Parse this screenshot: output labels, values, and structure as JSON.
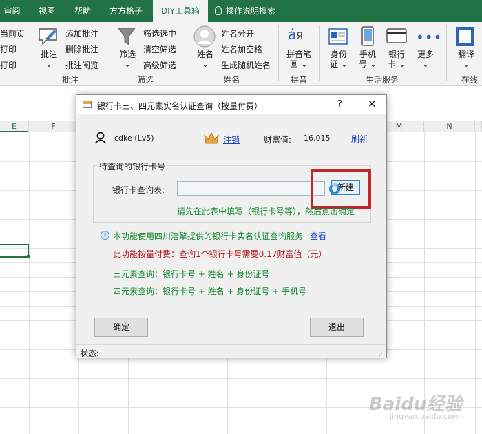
{
  "ribbon_tabs": [
    "审阅",
    "视图",
    "帮助",
    "方方格子",
    "DIY工具箱",
    "操作说明搜索"
  ],
  "ribbon": {
    "left_partial": [
      "当前页",
      "打印",
      "打印"
    ],
    "comment_group": {
      "big": "批注",
      "items": [
        "添加批注",
        "删除批注",
        "批注阅览"
      ],
      "label": "批注"
    },
    "filter_group": {
      "big": "筛选",
      "items": [
        "筛选选中",
        "清空筛选",
        "高级筛选"
      ],
      "label": "筛选"
    },
    "name_group": {
      "big": "姓名",
      "items": [
        "姓名分开",
        "姓名加空格",
        "生成随机姓名"
      ],
      "label": "姓名"
    },
    "pinyin_group": {
      "big_line1": "拼音笔",
      "big_line2": "画",
      "label": "拼音"
    },
    "life_group": {
      "btn1": "身份",
      "btn1b": "证",
      "btn2": "手机",
      "btn2b": "号",
      "btn3": "银行",
      "btn3b": "卡",
      "btn4": "更多",
      "label": "生活服务"
    },
    "translate": {
      "big": "翻译",
      "label_partial": "在线"
    }
  },
  "sheet": {
    "columns": [
      "E",
      "F",
      "M",
      "N"
    ]
  },
  "dialog": {
    "title": "银行卡三、四元素实名认证查询（按量付费）",
    "help": "?",
    "close": "✕",
    "user": "cdke (Lv5)",
    "logout": "注销",
    "wealth_label": "财富值:",
    "wealth_value": "16.015",
    "refresh": "刷新",
    "group_title": "待查询的银行卡号",
    "table_label": "银行卡查询表:",
    "table_value": "",
    "new_button": "新建",
    "hint": "请先在此表中填写（银行卡号等），然后点击确定",
    "info_text": "本功能使用四川涪擎提供的银行卡实名认证查询服务",
    "info_link": "查看",
    "pay_text": "此功能按量付费：查询1个银行卡号需要0.17财富值（元）",
    "three_elem": "三元素查询：银行卡号 + 姓名 + 身份证号",
    "four_elem": "四元素查询：银行卡号 + 姓名 + 身份证号 + 手机号",
    "ok": "确定",
    "exit": "退出",
    "status_label": "状态:"
  },
  "watermark": {
    "line1": "Baidu经验",
    "line2": "jingyan.baidu.com"
  }
}
